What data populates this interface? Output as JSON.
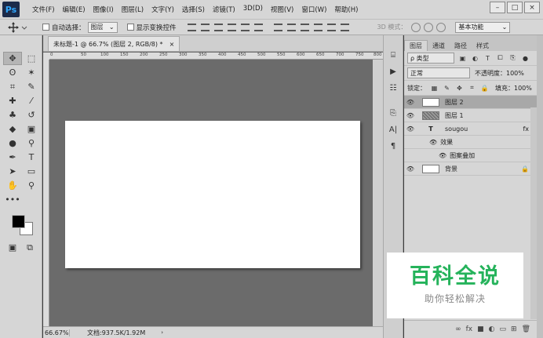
{
  "app": {
    "logo": "Ps"
  },
  "menu": [
    "文件(F)",
    "编辑(E)",
    "图像(I)",
    "图层(L)",
    "文字(Y)",
    "选择(S)",
    "滤镜(T)",
    "3D(D)",
    "视图(V)",
    "窗口(W)",
    "帮助(H)"
  ],
  "window_controls": {
    "minimize": "–",
    "maximize": "□",
    "close": "×"
  },
  "options": {
    "auto_select_label": "自动选择：",
    "auto_select_value": "图层",
    "show_transform_label": "显示变换控件",
    "mode_3d_label": "3D 模式：",
    "workspace_value": "基本功能"
  },
  "document": {
    "tab_title": "未标题-1 @ 66.7% (图层 2, RGB/8) *",
    "tab_close": "×",
    "ruler_marks": [
      "0",
      "50",
      "100",
      "150",
      "200",
      "250",
      "300",
      "350",
      "400",
      "450",
      "500",
      "550",
      "600",
      "650",
      "700",
      "750",
      "800"
    ]
  },
  "status": {
    "zoom": "66.67%",
    "doc_info": "文档:937.5K/1.92M",
    "arrow": "›"
  },
  "layers_panel": {
    "tabs": [
      "图层",
      "通道",
      "路径",
      "样式"
    ],
    "filter_value": "ρ 类型",
    "blend_mode": "正常",
    "opacity_label": "不透明度：",
    "opacity_value": "100%",
    "lock_label": "锁定：",
    "fill_label": "填充：",
    "fill_value": "100%",
    "layers": [
      {
        "name": "图层 2"
      },
      {
        "name": "图层 1"
      },
      {
        "name": "sougou",
        "type_icon": "T",
        "fx": "fx"
      },
      {
        "name": "效果"
      },
      {
        "name": "图案叠加"
      },
      {
        "name": "背景"
      }
    ],
    "footer_icons": [
      "∞",
      "fx",
      "■",
      "◐",
      "▭",
      "⊞",
      "🗑"
    ]
  },
  "watermark": {
    "main": "百科全说",
    "sub": "助你轻松解决",
    "color": "#25b35b"
  }
}
